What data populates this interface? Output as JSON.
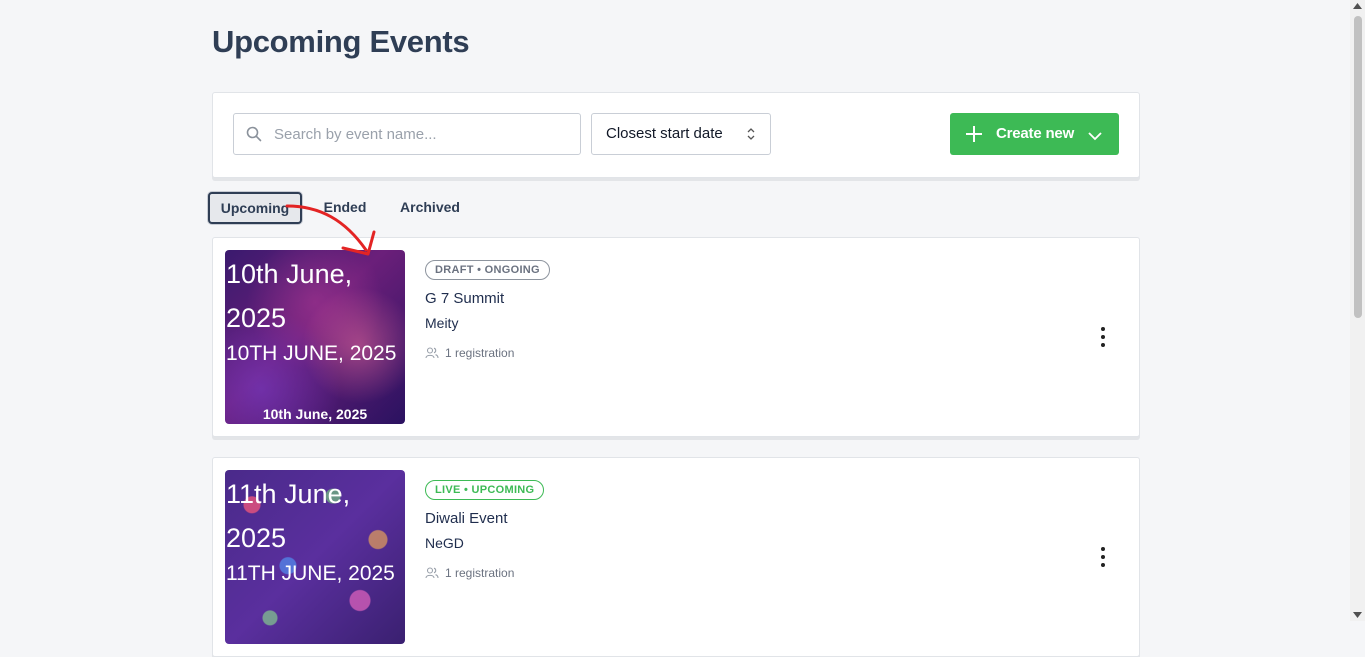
{
  "page": {
    "title": "Upcoming Events"
  },
  "toolbar": {
    "search_placeholder": "Search by event name...",
    "sort_label": "Closest start date",
    "create_label": "Create new",
    "accent_color": "#3dba55"
  },
  "tabs": [
    {
      "label": "Upcoming",
      "active": true
    },
    {
      "label": "Ended",
      "active": false
    },
    {
      "label": "Archived",
      "active": false
    }
  ],
  "events": [
    {
      "thumb_line1": "10th June, 2025",
      "thumb_line2": "10TH JUNE, 2025",
      "thumb_line3": "10th June, 2025",
      "status": "DRAFT • ONGOING",
      "name": "G 7 Summit",
      "organizer": "Meity",
      "registrations": "1 registration"
    },
    {
      "thumb_line1": "11th June, 2025",
      "thumb_line2": "11TH JUNE, 2025",
      "status": "LIVE • UPCOMING",
      "name": "Diwali Event",
      "organizer": "NeGD",
      "registrations": "1 registration"
    }
  ],
  "icons": {
    "search": "search-icon",
    "sort": "sort-chevrons-icon",
    "plus": "plus-icon",
    "caret": "chevron-down-icon",
    "users": "users-icon",
    "more": "kebab-menu-icon",
    "annotation": "red-arrow-annotation"
  }
}
